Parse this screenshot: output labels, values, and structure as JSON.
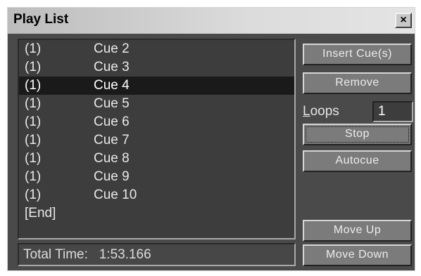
{
  "window": {
    "title": "Play List",
    "close_glyph": "×"
  },
  "playlist": {
    "rows": [
      {
        "loops": "(1)",
        "cue": "Cue 2",
        "selected": false
      },
      {
        "loops": "(1)",
        "cue": "Cue 3",
        "selected": false
      },
      {
        "loops": "(1)",
        "cue": "Cue 4",
        "selected": true
      },
      {
        "loops": "(1)",
        "cue": "Cue 5",
        "selected": false
      },
      {
        "loops": "(1)",
        "cue": "Cue 6",
        "selected": false
      },
      {
        "loops": "(1)",
        "cue": "Cue 7",
        "selected": false
      },
      {
        "loops": "(1)",
        "cue": "Cue 8",
        "selected": false
      },
      {
        "loops": "(1)",
        "cue": "Cue 9",
        "selected": false
      },
      {
        "loops": "(1)",
        "cue": "Cue 10",
        "selected": false
      }
    ],
    "end_marker": "[End]",
    "total_label": "Total Time:",
    "total_value": "1:53.166"
  },
  "buttons": {
    "insert": "Insert Cue(s)",
    "remove": "Remove",
    "stop": "Stop",
    "autocue": "Autocue",
    "move_up": "Move Up",
    "move_down": "Move Down"
  },
  "loops": {
    "label_first": "L",
    "label_rest": "oops",
    "value": "1"
  }
}
